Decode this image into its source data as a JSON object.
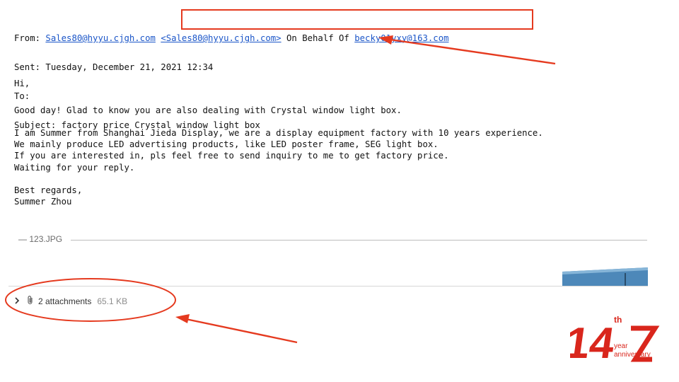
{
  "email": {
    "from_label": "From: ",
    "from_address": "Sales80@hyyu.cjgh.com",
    "from_display": "<Sales80@hyyu.cjgh.com>",
    "on_behalf_label": " On Behalf Of ",
    "on_behalf_address": "becky01yxy@163.com",
    "sent_line": "Sent: Tuesday, December 21, 2021 12:34",
    "to_line": "To:",
    "subject_line": "Subject: factory price Crystal window light box",
    "body": {
      "greeting": "Hi,",
      "p1": "Good day! Glad to know you are also dealing with Crystal window light box.",
      "p2_l1": "I am Summer from Shanghai Jieda Display, we are a display equipment factory with 10 years experience.",
      "p2_l2": "We mainly produce LED advertising products, like LED poster frame, SEG light box.",
      "p2_l3": "If you are interested in, pls feel free to send inquiry to me to get factory price.",
      "p2_l4": "Waiting for your reply.",
      "closing": "Best regards,",
      "signature": "Summer Zhou"
    },
    "attachment_separator": "123.JPG"
  },
  "attachments": {
    "toggle_icon": "chevron-right-icon",
    "paperclip_icon": "paperclip-icon",
    "label": "2 attachments",
    "size": "65.1 KB"
  },
  "watermark": {
    "text": "14th year anniversary",
    "color": "#d9261c"
  },
  "colors": {
    "annotation": "#e53a1f",
    "link": "#1a55c8"
  }
}
